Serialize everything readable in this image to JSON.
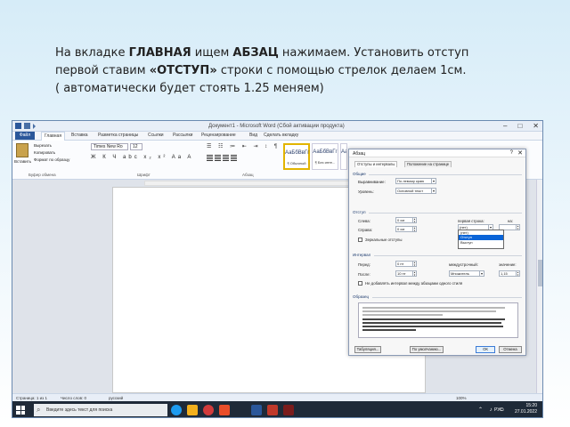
{
  "instruction": {
    "line1_a": "На вкладке ",
    "line1_b": "ГЛАВНАЯ",
    "line1_c": " ищем ",
    "line1_d": "АБЗАЦ",
    "line1_e": " нажимаем.  Установить отступ",
    "line2_a": "первой ставим ",
    "line2_b": "«ОТСТУП»",
    "line2_c": " строки  с помощью стрелок делаем 1см.",
    "line3": "( автоматически будет стоять 1.25 меняем)"
  },
  "word": {
    "title": "Документ1 - Microsoft Word (Сбой активации продукта)",
    "window_controls": [
      "–",
      "□",
      "✕"
    ],
    "tabs": [
      "Файл",
      "Главная",
      "Вставка",
      "Разметка страницы",
      "Ссылки",
      "Рассылки",
      "Рецензирование",
      "Вид",
      "Сделать вкладку"
    ],
    "ribbon": {
      "paste": "Вставить",
      "cut": "Вырезать",
      "copy": "Копировать",
      "format_painter": "Формат по образцу",
      "clipboard_group": "Буфер обмена",
      "font_name": "Times New Ro",
      "font_size": "12",
      "format_buttons": "Ж К Ч abc x₂ x² Aa A",
      "font_group": "Шрифт",
      "paragraph_group": "Абзац",
      "styles": [
        {
          "sample": "АаБбВвГг",
          "name": "¶ Обычный"
        },
        {
          "sample": "АаБбВвГг",
          "name": "¶ Без инте..."
        },
        {
          "sample": "АаБ",
          "name": "Заголово..."
        }
      ]
    },
    "status": {
      "page": "Страница: 1 из 1",
      "words": "Число слов: 0",
      "lang": "русский",
      "zoom": "100%"
    },
    "taskbar": {
      "search_placeholder": "Введите здесь текст для поиска",
      "lang": "РУС",
      "time": "15:20",
      "date": "27.01.2022"
    }
  },
  "dialog": {
    "title": "Абзац",
    "help": "?",
    "close": "✕",
    "tabs": [
      "Отступы и интервалы",
      "Положение на странице"
    ],
    "general": {
      "section": "Общие",
      "align_label": "Выравнивание:",
      "align_value": "По левому краю",
      "level_label": "Уровень:",
      "level_value": "Основной текст"
    },
    "indent": {
      "section": "Отступ",
      "left_label": "Слева:",
      "left_value": "0 см",
      "right_label": "Справа:",
      "right_value": "0 см",
      "first_line_label": "первая строка:",
      "first_line_value": "(нет)",
      "on_label": "на:",
      "mirror_label": "Зеркальные отступы",
      "first_line_options": [
        "(нет)",
        "Отступ",
        "Выступ"
      ]
    },
    "spacing": {
      "section": "Интервал",
      "before_label": "Перед:",
      "before_value": "0 пт",
      "after_label": "После:",
      "after_value": "10 пт",
      "line_label": "междустрочный:",
      "line_value": "Множитель",
      "at_label": "значение:",
      "at_value": "1,15",
      "no_space_label": "Не добавлять интервал между абзацами одного стиля"
    },
    "preview": {
      "section": "Образец"
    },
    "buttons": {
      "tabs": "Табуляция...",
      "default": "По умолчанию...",
      "ok": "ОК",
      "cancel": "Отмена"
    }
  }
}
